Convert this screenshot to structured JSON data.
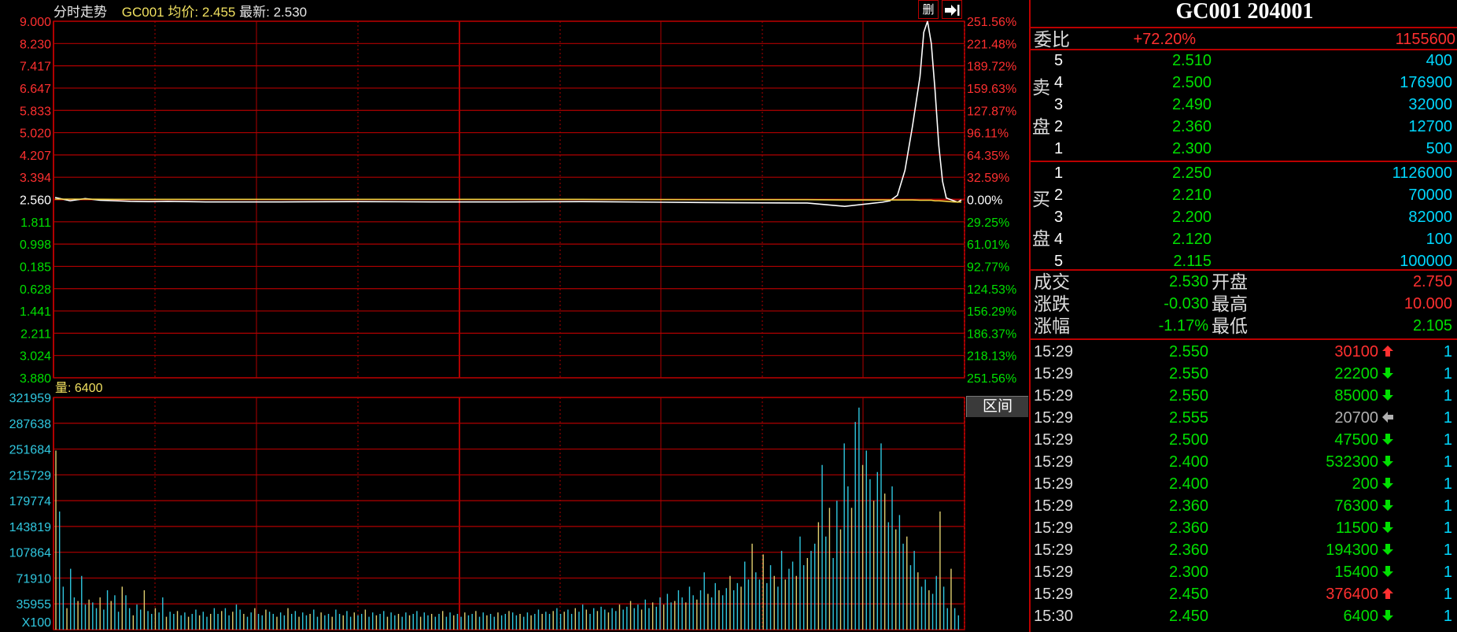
{
  "header": {
    "title": "分时走势",
    "code": "GC001",
    "avg_label": "均价:",
    "avg_value": "2.455",
    "last_label": "最新:",
    "last_value": "2.530",
    "delete_label": "删",
    "exit_icon": "arrow-right-exit-icon"
  },
  "colors": {
    "up": "#ff3030",
    "down": "#00e000",
    "grid": "#b00000",
    "volume_yellow": "#e0d070",
    "volume_cyan": "#30c8e0",
    "price_line": "#ffffff",
    "avg_line": "#f0d040"
  },
  "chart_data": [
    {
      "type": "line",
      "name": "price",
      "y_ticks": [
        "9.000",
        "8.230",
        "7.417",
        "6.647",
        "5.833",
        "5.020",
        "4.207",
        "3.394",
        "2.560",
        "1.811",
        "0.998",
        "0.185",
        "0.628",
        "1.441",
        "2.211",
        "3.024",
        "3.880"
      ],
      "y_ticks_colors": [
        "up",
        "up",
        "up",
        "up",
        "up",
        "up",
        "up",
        "up",
        "neutral",
        "down",
        "down",
        "down",
        "down",
        "down",
        "down",
        "down",
        "down"
      ],
      "pct_ticks": [
        "251.56%",
        "221.48%",
        "189.72%",
        "159.63%",
        "127.87%",
        "96.11%",
        "64.35%",
        "32.59%",
        "0.00%",
        "29.25%",
        "61.01%",
        "92.77%",
        "124.53%",
        "156.29%",
        "186.37%",
        "218.13%",
        "251.56%"
      ],
      "ylim": [
        -3.88,
        9.0
      ],
      "base": 2.56,
      "x": [
        0,
        4,
        8,
        12,
        16,
        20,
        25,
        30,
        40,
        60,
        80,
        100,
        120,
        140,
        160,
        180,
        200,
        210,
        220,
        222,
        224,
        226,
        228,
        230,
        231,
        232,
        233,
        234,
        235,
        236,
        237,
        238,
        239,
        240,
        241
      ],
      "price": [
        2.62,
        2.5,
        2.58,
        2.52,
        2.5,
        2.48,
        2.47,
        2.48,
        2.46,
        2.46,
        2.47,
        2.46,
        2.46,
        2.47,
        2.45,
        2.43,
        2.42,
        2.3,
        2.45,
        2.5,
        2.7,
        3.6,
        5.2,
        7.0,
        8.6,
        9.0,
        8.2,
        6.5,
        4.5,
        3.2,
        2.6,
        2.55,
        2.5,
        2.45,
        2.53
      ],
      "avg": [
        2.56,
        2.56,
        2.56,
        2.555,
        2.55,
        2.55,
        2.55,
        2.55,
        2.55,
        2.55,
        2.55,
        2.55,
        2.55,
        2.55,
        2.545,
        2.54,
        2.54,
        2.53,
        2.53,
        2.53,
        2.53,
        2.53,
        2.53,
        2.52,
        2.52,
        2.52,
        2.52,
        2.5,
        2.5,
        2.49,
        2.48,
        2.47,
        2.46,
        2.455,
        2.455
      ]
    },
    {
      "type": "bar",
      "name": "volume",
      "label": "量:",
      "label_value": "6400",
      "y_ticks": [
        "321959",
        "287638",
        "251684",
        "215729",
        "179774",
        "143819",
        "107864",
        "71910",
        "35955"
      ],
      "multiplier_label": "X100",
      "ylim": [
        0,
        321959
      ],
      "values": [
        250000,
        165000,
        60000,
        30000,
        85000,
        45000,
        40000,
        75000,
        35000,
        42000,
        38000,
        30000,
        45000,
        28000,
        55000,
        40000,
        48000,
        25000,
        60000,
        48000,
        30000,
        20000,
        35000,
        28000,
        55000,
        26000,
        22000,
        30000,
        24000,
        45000,
        18000,
        25000,
        22000,
        26000,
        20000,
        24000,
        18000,
        22000,
        28000,
        20000,
        25000,
        18000,
        22000,
        30000,
        22000,
        26000,
        30000,
        20000,
        25000,
        35000,
        28000,
        22000,
        18000,
        24000,
        30000,
        22000,
        20000,
        28000,
        25000,
        22000,
        18000,
        24000,
        20000,
        30000,
        22000,
        26000,
        18000,
        24000,
        20000,
        22000,
        28000,
        18000,
        24000,
        20000,
        22000,
        18000,
        28000,
        22000,
        20000,
        26000,
        18000,
        24000,
        20000,
        22000,
        28000,
        18000,
        24000,
        20000,
        22000,
        26000,
        18000,
        24000,
        20000,
        22000,
        18000,
        24000,
        20000,
        22000,
        26000,
        18000,
        24000,
        20000,
        22000,
        18000,
        22000,
        26000,
        18000,
        24000,
        20000,
        22000,
        18000,
        24000,
        20000,
        22000,
        26000,
        18000,
        24000,
        20000,
        22000,
        18000,
        24000,
        20000,
        22000,
        26000,
        24000,
        20000,
        22000,
        18000,
        24000,
        20000,
        22000,
        28000,
        22000,
        25000,
        22000,
        26000,
        30000,
        22000,
        25000,
        28000,
        22000,
        30000,
        25000,
        35000,
        28000,
        22000,
        30000,
        26000,
        32000,
        28000,
        24000,
        30000,
        26000,
        35000,
        28000,
        32000,
        40000,
        30000,
        35000,
        28000,
        42000,
        30000,
        38000,
        32000,
        45000,
        35000,
        50000,
        38000,
        40000,
        55000,
        45000,
        38000,
        60000,
        48000,
        42000,
        55000,
        80000,
        50000,
        45000,
        65000,
        55000,
        48000,
        58000,
        75000,
        55000,
        65000,
        60000,
        95000,
        70000,
        120000,
        80000,
        70000,
        105000,
        65000,
        90000,
        75000,
        60000,
        110000,
        70000,
        85000,
        95000,
        75000,
        130000,
        90000,
        100000,
        110000,
        120000,
        150000,
        230000,
        130000,
        170000,
        100000,
        180000,
        140000,
        260000,
        200000,
        170000,
        290000,
        310000,
        230000,
        250000,
        210000,
        180000,
        220000,
        260000,
        190000,
        150000,
        200000,
        140000,
        160000,
        120000,
        130000,
        90000,
        110000,
        80000,
        60000,
        70000,
        55000,
        50000,
        75000,
        165000,
        60000,
        30000,
        85000,
        30000,
        20000
      ],
      "colors_pattern": "alternating cyan / yellow"
    }
  ],
  "quote": {
    "title": "GC001 204001",
    "weibi_label": "委比",
    "weibi_pct": "+72.20%",
    "weibi_diff": "1155600",
    "sell_label_1": "卖",
    "sell_label_2": "盘",
    "buy_label_1": "买",
    "buy_label_2": "盘",
    "sell": [
      {
        "level": "5",
        "price": "2.510",
        "vol": "400"
      },
      {
        "level": "4",
        "price": "2.500",
        "vol": "176900"
      },
      {
        "level": "3",
        "price": "2.490",
        "vol": "32000"
      },
      {
        "level": "2",
        "price": "2.360",
        "vol": "12700"
      },
      {
        "level": "1",
        "price": "2.300",
        "vol": "500"
      }
    ],
    "buy": [
      {
        "level": "1",
        "price": "2.250",
        "vol": "1126000"
      },
      {
        "level": "2",
        "price": "2.210",
        "vol": "70000"
      },
      {
        "level": "3",
        "price": "2.200",
        "vol": "82000"
      },
      {
        "level": "4",
        "price": "2.120",
        "vol": "100"
      },
      {
        "level": "5",
        "price": "2.115",
        "vol": "100000"
      }
    ],
    "stats": [
      {
        "l1": "成交",
        "v1": "2.530",
        "l2": "开盘",
        "v2": "2.750",
        "c1": "green",
        "c2": "red"
      },
      {
        "l1": "涨跌",
        "v1": "-0.030",
        "l2": "最高",
        "v2": "10.000",
        "c1": "green",
        "c2": "red"
      },
      {
        "l1": "涨幅",
        "v1": "-1.17%",
        "l2": "最低",
        "v2": "2.105",
        "c1": "green",
        "c2": "green"
      }
    ]
  },
  "ticks": [
    {
      "time": "15:29",
      "price": "2.550",
      "vol": "30100",
      "dir": "up",
      "n": "1"
    },
    {
      "time": "15:29",
      "price": "2.550",
      "vol": "22200",
      "dir": "down",
      "n": "1"
    },
    {
      "time": "15:29",
      "price": "2.550",
      "vol": "85000",
      "dir": "down",
      "n": "1"
    },
    {
      "time": "15:29",
      "price": "2.555",
      "vol": "20700",
      "dir": "flat",
      "n": "1"
    },
    {
      "time": "15:29",
      "price": "2.500",
      "vol": "47500",
      "dir": "down",
      "n": "1"
    },
    {
      "time": "15:29",
      "price": "2.400",
      "vol": "532300",
      "dir": "down",
      "n": "1"
    },
    {
      "time": "15:29",
      "price": "2.400",
      "vol": "200",
      "dir": "down",
      "n": "1"
    },
    {
      "time": "15:29",
      "price": "2.360",
      "vol": "76300",
      "dir": "down",
      "n": "1"
    },
    {
      "time": "15:29",
      "price": "2.360",
      "vol": "11500",
      "dir": "down",
      "n": "1"
    },
    {
      "time": "15:29",
      "price": "2.360",
      "vol": "194300",
      "dir": "down",
      "n": "1"
    },
    {
      "time": "15:29",
      "price": "2.300",
      "vol": "15400",
      "dir": "down",
      "n": "1"
    },
    {
      "time": "15:29",
      "price": "2.450",
      "vol": "376400",
      "dir": "up",
      "n": "1"
    },
    {
      "time": "15:30",
      "price": "2.450",
      "vol": "6400",
      "dir": "down",
      "n": "1"
    }
  ],
  "range_button": "区间"
}
